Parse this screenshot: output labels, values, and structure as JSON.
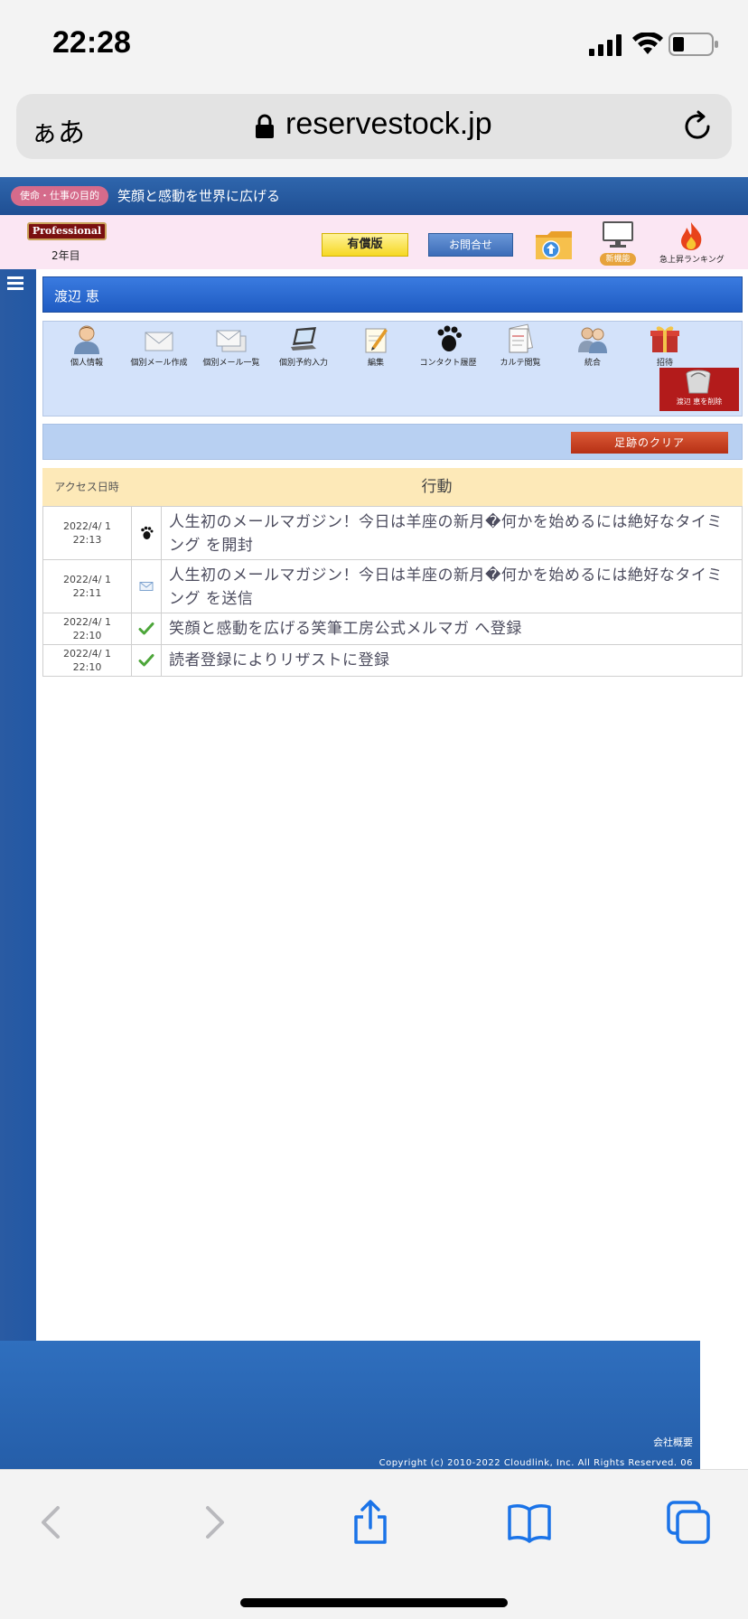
{
  "status": {
    "time": "22:28"
  },
  "browser": {
    "aa_label": "ぁあ",
    "url": "reservestock.jp"
  },
  "site": {
    "mission_label": "使命・仕事の目的",
    "mission_text": "笑顔と感動を世界に広げる",
    "plan_badge": "Professional",
    "year_label": "2年目",
    "paid_label": "有償版",
    "contact_label": "お問合せ",
    "new_feature_label": "新機能",
    "ranking_label": "急上昇ランキング"
  },
  "customer": {
    "name": "渡辺 恵",
    "actions": [
      {
        "label": "個人情報",
        "icon": "person-icon"
      },
      {
        "label": "個別メール作成",
        "icon": "envelope-icon"
      },
      {
        "label": "個別メール一覧",
        "icon": "envelopes-icon"
      },
      {
        "label": "個別予約入力",
        "icon": "laptop-icon"
      },
      {
        "label": "編集",
        "icon": "edit-icon"
      },
      {
        "label": "コンタクト履歴",
        "icon": "footprint-icon"
      },
      {
        "label": "カルテ閲覧",
        "icon": "chart-card-icon"
      },
      {
        "label": "統合",
        "icon": "merge-people-icon"
      },
      {
        "label": "招待",
        "icon": "gift-icon"
      }
    ],
    "delete_label": "渡辺 恵を削除",
    "clear_label": "足跡のクリア"
  },
  "log": {
    "col_date": "アクセス日時",
    "col_action": "行動",
    "rows": [
      {
        "date": "2022/4/ 1",
        "time": "22:13",
        "icon": "footprint-icon",
        "text": "人生初のメールマガジン！今日は羊座の新月�何かを始めるには絶好なタイミング を開封"
      },
      {
        "date": "2022/4/ 1",
        "time": "22:11",
        "icon": "mail-sent-icon",
        "text": "人生初のメールマガジン！今日は羊座の新月�何かを始めるには絶好なタイミング を送信"
      },
      {
        "date": "2022/4/ 1",
        "time": "22:10",
        "icon": "check-icon",
        "text": "笑顔と感動を広げる笑筆工房公式メルマガ へ登録"
      },
      {
        "date": "2022/4/ 1",
        "time": "22:10",
        "icon": "check-icon",
        "text": "読者登録によりリザストに登録"
      }
    ]
  },
  "footer": {
    "company_link": "会社概要",
    "copyright": "Copyright (c) 2010-2022 Cloudlink, Inc. All Rights Reserved. 06"
  }
}
